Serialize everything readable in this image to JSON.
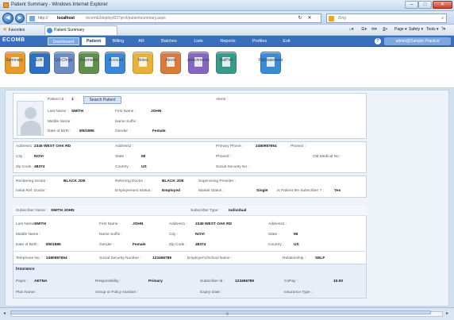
{
  "window": {
    "title": "Patient Summary - Windows Internet Explorer",
    "min": "–",
    "max": "□",
    "close": "✕"
  },
  "addressbar": {
    "url_scheme": "http://",
    "url_host": "localhost",
    "url_path": "/ecomb2deploy/837prof/patientsummary.aspx",
    "back": "◀",
    "forward": "▶",
    "refresh": "↻",
    "stop": "✕",
    "search_provider": "Bing",
    "search_icon": "⌕"
  },
  "favbar": {
    "favorites_label": "Favorites",
    "tab_label": "Patient Summary",
    "tools": [
      "Page ▾",
      "Safety ▾",
      "Tools ▾",
      "?▾"
    ]
  },
  "app": {
    "logo": "ECOMB",
    "menu": [
      "Dashboard",
      "Patient",
      "Billing",
      "AR",
      "Batches",
      "Lists",
      "Reports",
      "Profiles",
      "Exit"
    ],
    "help": "?",
    "user": "admin@Sample Practice"
  },
  "toolbar": [
    {
      "label": "Summary",
      "color": "#e59a2b"
    },
    {
      "label": "Edit",
      "color": "#2f6fc3"
    },
    {
      "label": "QckChrgs",
      "color": "#6a8cc2"
    },
    {
      "label": "Payments",
      "color": "#5f8f4a"
    },
    {
      "label": "Account",
      "color": "#3b86d9"
    },
    {
      "label": "Notes",
      "color": "#e8b23a"
    },
    {
      "label": "Alerts",
      "color": "#d97b3c"
    },
    {
      "label": "Attachments",
      "color": "#8566c2"
    },
    {
      "label": "BatPmt",
      "color": "#3a9a8a"
    },
    {
      "label": "PatStatement",
      "color": "#3a8ad6"
    }
  ],
  "patient": {
    "id_label": "Patient Id :",
    "id": "1",
    "search_button": "Search Patient",
    "alerts_label": "Alerts :",
    "last_name_label": "Last Name :",
    "last_name": "SMITH",
    "first_name_label": "First Name :",
    "first_name": "JOHN",
    "middle_name_label": "Middle Name :",
    "name_suffix_label": "Name Suffix :",
    "dob_label": "Date of Birth :",
    "dob": "8/8/1985",
    "gender_label": "Gender :",
    "gender": "Female",
    "address1_label": "Address1 :",
    "address1": "2345 WEST OAK RD",
    "address2_label": "Address2 :",
    "primary_phone_label": "Primary Phone :",
    "primary_phone": "2480987654",
    "phone2_label": "Phone2 :",
    "city_label": "City :",
    "city": "NOVI",
    "state_label": "State :",
    "state": "MI",
    "phone3_label": "Phone3 :",
    "old_medical_label": "Old Medical No :",
    "zip_label": "Zip Code :",
    "zip": "48374",
    "country_label": "Country :",
    "country": "US",
    "ssn_label": "Social Security No :",
    "rendering_label": "Rendering Doctor :",
    "rendering": "BLACK JOE",
    "referring_label": "Referring Doctor :",
    "referring": "BLACK JOE",
    "supervising_label": "Supervising Provider :",
    "initial_ref_label": "Initial Ref. Doctor :",
    "employment_label": "Employement Status :",
    "employment": "Employed",
    "marital_label": "Marital Status :",
    "marital": "Single",
    "is_subscriber_label": "Is Patient the Subscriber ? :",
    "is_subscriber": "Yes"
  },
  "subscriber": {
    "name_label": "Subscriber Name :",
    "name": "SMITH JOHN",
    "type_label": "Subscriber Type :",
    "type": "Individual",
    "last_name_label": "Last Name :",
    "last_name": "SMITH",
    "first_name_label": "First Name :",
    "first_name": "JOHN",
    "address1_label": "Address1 :",
    "address1": "2345 WEST OAK RD",
    "address2_label": "Address2 :",
    "middle_name_label": "Middle Name :",
    "name_suffix_label": "Name Suffix :",
    "city_label": "City :",
    "city": "NOVI",
    "state_label": "State :",
    "state": "MI",
    "dob_label": "Date of Birth :",
    "dob": "8/8/1985",
    "gender_label": "Gender :",
    "gender": "Female",
    "zip_label": "Zip Code :",
    "zip": "48374",
    "country_label": "Country :",
    "country": "US",
    "phone_label": "Telephone No. :",
    "phone": "2480987654",
    "ssn_label": "Social Security Number :",
    "ssn": "123456789",
    "employer_label": "Employer's/School Name :",
    "relationship_label": "Relationship :",
    "relationship": "SELF"
  },
  "insurance": {
    "header": "Insurance",
    "payer_label": "Payer :",
    "payer": "AETNA",
    "responsibility_label": "Responsibility :",
    "responsibility": "Primary",
    "subscriber_id_label": "Subscriber Id :",
    "subscriber_id": "123456789",
    "copay_label": "CoPay :",
    "copay": "10.00",
    "plan_label": "Plan Name :",
    "group_label": "Group or Policy Number :",
    "expiry_label": "Expiry Date :",
    "ins_type_label": "Insurance Type :"
  },
  "statusbar": {
    "left": "◂",
    "right": "▸",
    "grip": "|||"
  }
}
